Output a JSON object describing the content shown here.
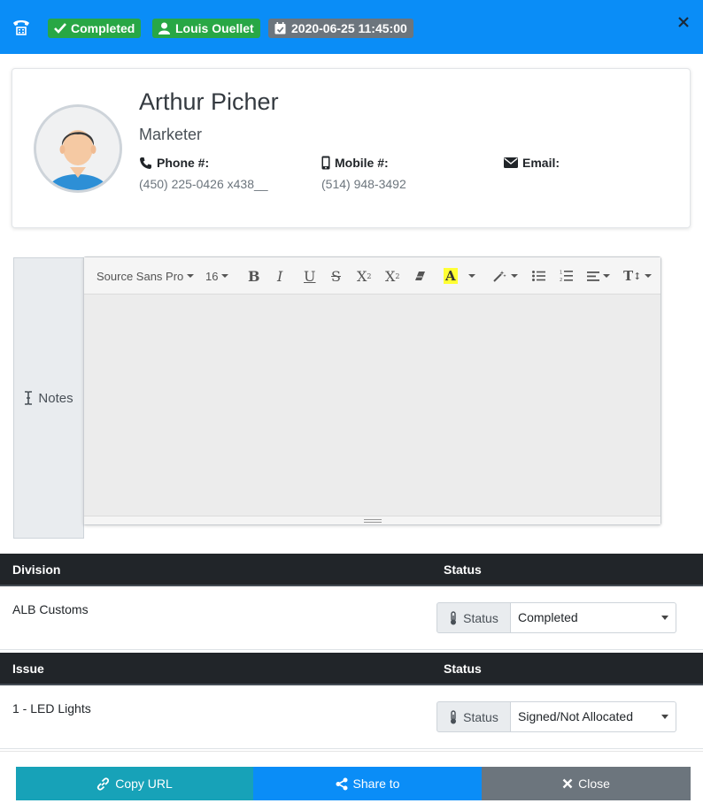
{
  "header": {
    "status_badge": "Completed",
    "user_badge": "Louis Ouellet",
    "date_badge": "2020-06-25 11:45:00",
    "bg_color": "#0a8df7",
    "logo_icon": "phone-icon"
  },
  "contact": {
    "name": "Arthur Picher",
    "role": "Marketer",
    "phone_label": "Phone #:",
    "phone_value": "(450) 225-0426 x438__",
    "mobile_label": "Mobile #:",
    "mobile_value": "(514) 948-3492",
    "email_label": "Email:",
    "email_value": ""
  },
  "notes": {
    "label": "Notes",
    "toolbar": {
      "font_family": "Source Sans Pro",
      "font_size": "16",
      "buttons": [
        "bold",
        "italic",
        "underline",
        "strikethrough",
        "superscript",
        "subscript",
        "eraser",
        "color",
        "magic",
        "unordered-list",
        "ordered-list",
        "align",
        "text-height"
      ]
    },
    "content": ""
  },
  "tables": [
    {
      "col1_header": "Division",
      "col2_header": "Status",
      "row_label": "ALB Customs",
      "status_prefix": "Status",
      "status_value": "Completed"
    },
    {
      "col1_header": "Issue",
      "col2_header": "Status",
      "row_label": "1 - LED Lights",
      "status_prefix": "Status",
      "status_value": "Signed/Not Allocated"
    }
  ],
  "footer": {
    "copy_url": "Copy URL",
    "share_to": "Share to",
    "close": "Close"
  },
  "colors": {
    "accent": "#0a8df7",
    "success": "#28a745",
    "secondary": "#6c757d",
    "info": "#17a2b8",
    "dark": "#212529"
  }
}
